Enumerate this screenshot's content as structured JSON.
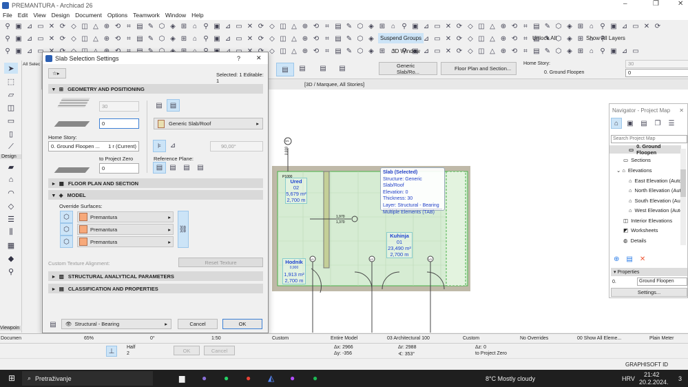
{
  "window": {
    "title": "PREMANTURA - Archicad 26",
    "minimize": "–",
    "maximize": "❐",
    "close": "✕"
  },
  "menu": [
    "File",
    "Edit",
    "View",
    "Design",
    "Document",
    "Options",
    "Teamwork",
    "Window",
    "Help"
  ],
  "toolbars": {
    "suspend_groups": "Suspend Groups",
    "unlock_all": "Unlock All",
    "show_all_layers": "Show All Layers",
    "window_3d": "3D Window"
  },
  "toolbox": {
    "all_selection": "All Selec",
    "design": "Design",
    "viewpoint": "Viewpoin"
  },
  "infobox": {
    "slab_type": "Generic Slab/Ro...",
    "floor_plan": "Floor Plan and Section...",
    "home_story_label": "Home Story:",
    "home_story": "0. Ground Floopen",
    "thickness": "30",
    "elevation": "0"
  },
  "tab": {
    "label": "[3D / Marquee, All Stories]"
  },
  "dialog": {
    "title": "Slab Selection Settings",
    "help": "?",
    "close": "✕",
    "selected": "Selected: 1 Editable: 1",
    "sections": {
      "geometry": "GEOMETRY AND POSITIONING",
      "floorplan": "FLOOR PLAN AND SECTION",
      "model": "MODEL",
      "structural": "STRUCTURAL ANALYTICAL PARAMETERS",
      "classification": "CLASSIFICATION AND PROPERTIES"
    },
    "thickness": "30",
    "offset": "0",
    "home_story_label": "Home Story:",
    "home_story": "0. Ground Floopen ...",
    "home_story_offset": "1 r (Current)",
    "to_project_zero": "to Project Zero",
    "project_zero_value": "0",
    "composite": "Generic Slab/Roof",
    "angle": "90,00°",
    "reference_plane": "Reference Plane:",
    "override_surfaces": "Override Surfaces:",
    "surfaces": [
      "Premantura",
      "Premantura",
      "Premantura"
    ],
    "custom_texture": "Custom Texture Alignment:",
    "reset_texture": "Reset Texture",
    "layer": "Structural - Bearing",
    "cancel": "Cancel",
    "ok": "OK"
  },
  "plan": {
    "tooltip": [
      "Slab (Selected)",
      "Structure: Generic Slab/Roof",
      "Elevation: 0",
      "Thickness: 30",
      "Layer: Structural - Bearing",
      "Multiple Elements (TAB)"
    ],
    "rooms": [
      {
        "name": "Ured",
        "number": "02",
        "area": "5,679 m²",
        "height": "2,700 m"
      },
      {
        "name": "Kuhinja",
        "number": "01",
        "area": "23,490 m²",
        "height": "2,700 m"
      },
      {
        "name": "Hodnik",
        "number": "0,900",
        "area": "1,913 m²",
        "height": "2,700 m"
      }
    ],
    "markers": [
      "W1",
      "V1",
      "V2",
      "V3"
    ],
    "dim_top": "1,970",
    "dim_bottom": "1,370",
    "label_p": "P1000",
    "window_dims": "0,800"
  },
  "navigator": {
    "title": "Navigator - Project Map",
    "search_placeholder": "Search Project Map",
    "items": [
      "0. Ground Floopen",
      "Sections",
      "Elevations",
      "East Elevation (Auto-r",
      "North Elevation (Auto",
      "South Elevation (Auto",
      "West Elevation (Auto-",
      "Interior Elevations",
      "Worksheets",
      "Details"
    ],
    "properties": "Properties",
    "prop_id": "0.",
    "prop_name": "Ground Floopen",
    "settings": "Settings..."
  },
  "status": {
    "document": "Documen",
    "zoom": "65%",
    "angle": "0°",
    "scale": "1:50",
    "custom1": "Custom",
    "model": "Entire Model",
    "pen": "03 Architectural 100",
    "custom2": "Custom",
    "overrides": "No Overrides",
    "layers": "00 Show All Eleme...",
    "units": "Plain Meter"
  },
  "bottom": {
    "half": "Half",
    "half_n": "2",
    "ok": "OK",
    "cancel": "Cancel",
    "dx": "Δx: 2966",
    "dy": "Δy: -356",
    "dr": "Δr: 2988",
    "da": "∢: 353°",
    "dz": "Δz: 0",
    "to_project_zero": "to Project Zero"
  },
  "graphisoft": "GRAPHISOFT ID",
  "taskbar": {
    "search": "Pretraživanje",
    "weather": "8°C  Mostly cloudy",
    "lang": "HRV",
    "time": "21:42",
    "date": "20.2.2024.",
    "notif": "3"
  },
  "colors": {
    "accent": "#cce4f7",
    "slab": "#d6ecd3",
    "room_text": "#1a3fd0",
    "taskbar": "#1f1f1f"
  }
}
